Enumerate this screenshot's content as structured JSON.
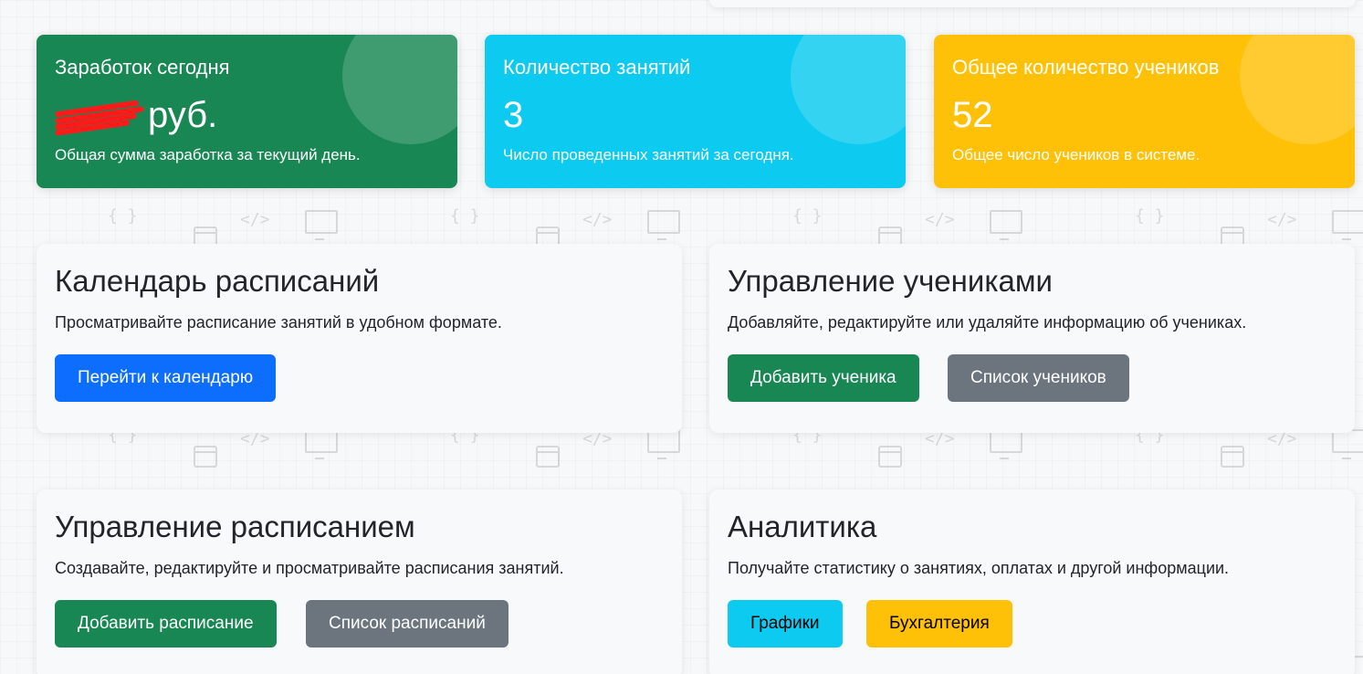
{
  "stats": [
    {
      "title": "Заработок сегодня",
      "value": "руб.",
      "value_redacted": true,
      "description": "Общая сумма заработка за текущий день.",
      "color": "#198754"
    },
    {
      "title": "Количество занятий",
      "value": "3",
      "description": "Число проведенных занятий за сегодня.",
      "color": "#0dcaf0"
    },
    {
      "title": "Общее количество учеников",
      "value": "52",
      "description": "Общее число учеников в системе.",
      "color": "#ffc107"
    }
  ],
  "calendar": {
    "title": "Календарь расписаний",
    "description": "Просматривайте расписание занятий в удобном формате.",
    "button": "Перейти к календарю"
  },
  "students": {
    "title": "Управление учениками",
    "description": "Добавляйте, редактируйте или удаляйте информацию об учениках.",
    "add_button": "Добавить ученика",
    "list_button": "Список учеников"
  },
  "schedule": {
    "title": "Управление расписанием",
    "description": "Создавайте, редактируйте и просматривайте расписания занятий.",
    "add_button": "Добавить расписание",
    "list_button": "Список расписаний"
  },
  "analytics": {
    "title": "Аналитика",
    "description": "Получайте статистику о занятиях, оплатах и другой информации.",
    "charts_button": "Графики",
    "accounting_button": "Бухгалтерия"
  },
  "pattern_glyphs": {
    "braces": "{ }",
    "code": "</>"
  }
}
